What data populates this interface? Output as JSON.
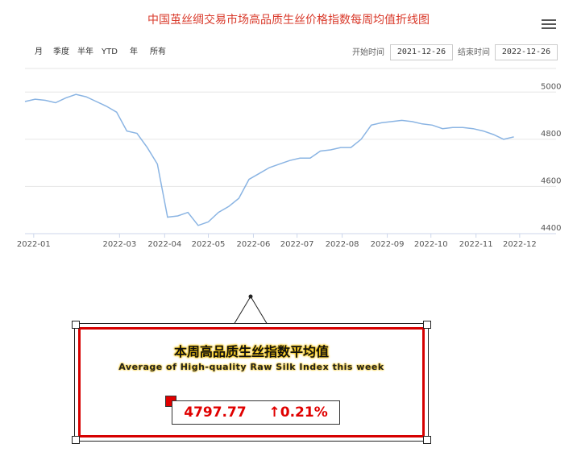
{
  "title": "中国茧丝绸交易市场高品质生丝价格指数每周均值折线图",
  "range_buttons": [
    "月",
    "季度",
    "半年",
    "YTD",
    "年",
    "所有"
  ],
  "date_range": {
    "start_label": "开始时间",
    "start_value": "2021-12-26",
    "end_label": "结束时间",
    "end_value": "2022-12-26"
  },
  "icons": {
    "menu": "hamburger-menu-icon"
  },
  "colors": {
    "line": "#8ab4e3",
    "title": "#d93a2b",
    "accent": "#e00000",
    "card_border": "#d60000",
    "glow": "#f5c200"
  },
  "chart_data": {
    "type": "line",
    "title": "中国茧丝绸交易市场高品质生丝价格指数每周均值折线图",
    "xlabel": "",
    "ylabel": "",
    "x_ticks": [
      "2022-01",
      "2022-03",
      "2022-04",
      "2022-05",
      "2022-06",
      "2022-07",
      "2022-08",
      "2022-09",
      "2022-10",
      "2022-11",
      "2022-12"
    ],
    "x_tick_dates": [
      "2022-01-01",
      "2022-03-01",
      "2022-04-01",
      "2022-05-01",
      "2022-06-01",
      "2022-07-01",
      "2022-08-01",
      "2022-09-01",
      "2022-10-01",
      "2022-11-01",
      "2022-12-01"
    ],
    "y_ticks": [
      4400,
      4600,
      4800,
      5000
    ],
    "ylim": [
      4400,
      5100
    ],
    "grid": true,
    "y_axis_side": "right",
    "x": [
      "2021-12-26",
      "2022-01-02",
      "2022-01-09",
      "2022-01-16",
      "2022-01-23",
      "2022-01-30",
      "2022-02-06",
      "2022-02-13",
      "2022-02-20",
      "2022-02-27",
      "2022-03-06",
      "2022-03-13",
      "2022-03-20",
      "2022-03-27",
      "2022-04-03",
      "2022-04-10",
      "2022-04-17",
      "2022-04-24",
      "2022-05-01",
      "2022-05-08",
      "2022-05-15",
      "2022-05-22",
      "2022-05-29",
      "2022-06-05",
      "2022-06-12",
      "2022-06-19",
      "2022-06-26",
      "2022-07-03",
      "2022-07-10",
      "2022-07-17",
      "2022-07-24",
      "2022-07-31",
      "2022-08-07",
      "2022-08-14",
      "2022-08-21",
      "2022-08-28",
      "2022-09-04",
      "2022-09-11",
      "2022-09-18",
      "2022-09-25",
      "2022-10-02",
      "2022-10-09",
      "2022-10-16",
      "2022-10-23",
      "2022-10-30",
      "2022-11-06",
      "2022-11-13",
      "2022-11-20",
      "2022-11-27",
      "2022-12-04",
      "2022-12-11",
      "2022-12-18",
      "2022-12-26"
    ],
    "series": [
      {
        "values": [
          4960,
          4970,
          4965,
          4955,
          4975,
          4990,
          4980,
          4960,
          4940,
          4915,
          4835,
          4825,
          4765,
          4695,
          4470,
          4475,
          4490,
          4435,
          4450,
          4490,
          4515,
          4550,
          4630,
          4655,
          4680,
          4695,
          4710,
          4720,
          4720,
          4750,
          4755,
          4765,
          4765,
          4800,
          4860,
          4870,
          4875,
          4880,
          4875,
          4865,
          4860,
          4845,
          4850,
          4850,
          4845,
          4835,
          4820,
          4800,
          4810
        ]
      }
    ]
  },
  "summary_card": {
    "title_cn": "本周高品质生丝指数平均值",
    "title_en": "Average of High-quality Raw Silk Index this week",
    "value": "4797.77",
    "change": "↑0.21%"
  }
}
